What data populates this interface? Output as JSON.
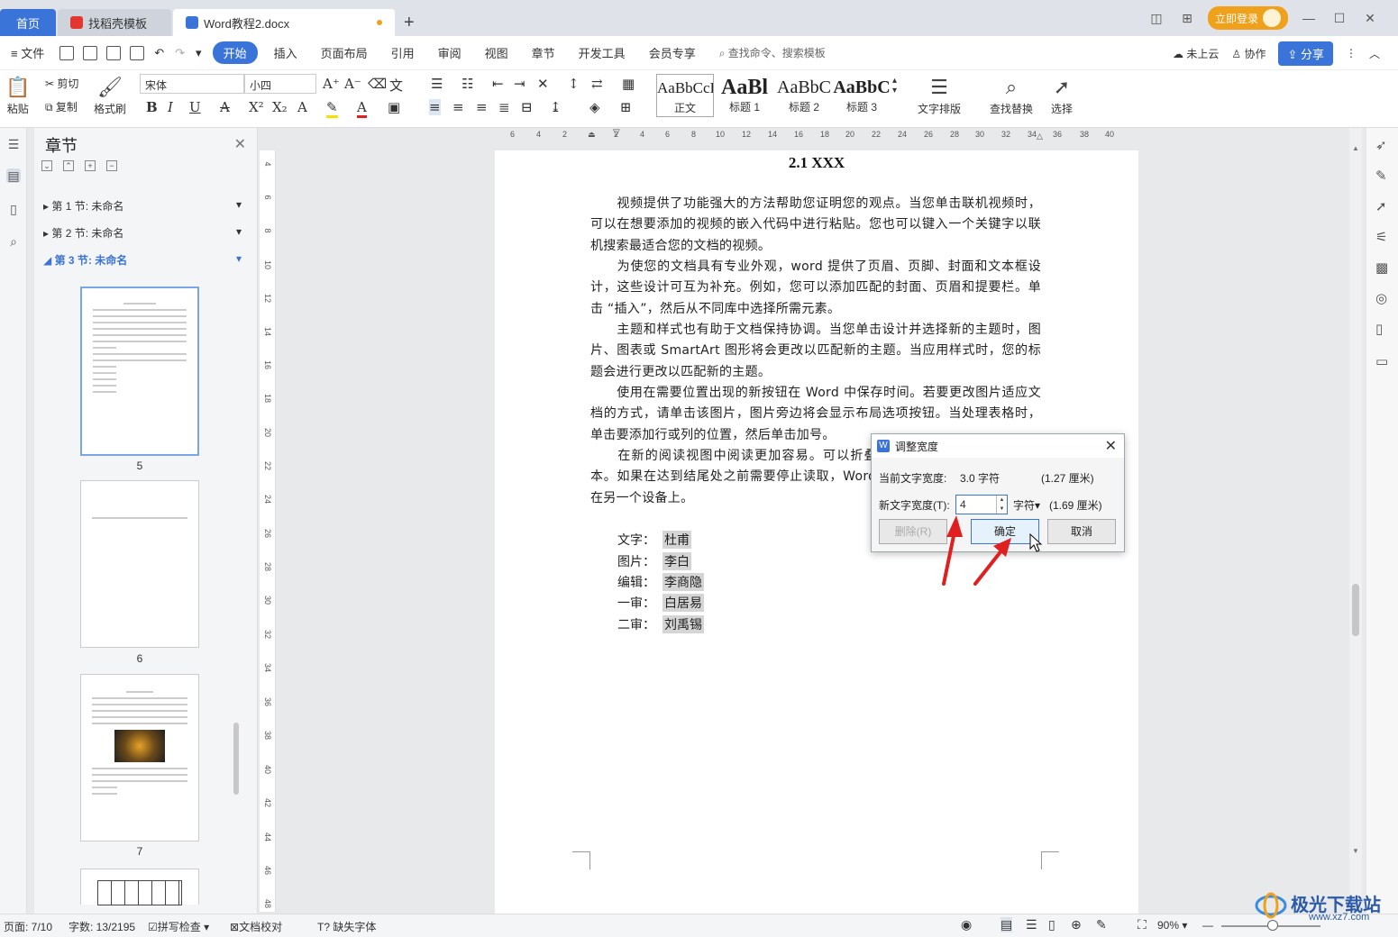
{
  "titlebar": {
    "tabs": [
      {
        "label": "首页"
      },
      {
        "label": "找稻壳模板"
      },
      {
        "label": "Word教程2.docx"
      }
    ],
    "login_label": "立即登录"
  },
  "menubar": {
    "file_label": "文件",
    "items": [
      "开始",
      "插入",
      "页面布局",
      "引用",
      "审阅",
      "视图",
      "章节",
      "开发工具",
      "会员专享"
    ],
    "search_placeholder": "查找命令、搜索模板",
    "cloud_label": "未上云",
    "collab_label": "协作",
    "share_label": "分享"
  },
  "ribbon": {
    "paste": "粘贴",
    "cut": "剪切",
    "copy": "复制",
    "format_painter": "格式刷",
    "font_name": "宋体",
    "font_size": "小四",
    "styles": [
      {
        "sample": "AaBbCcI",
        "name": "正文"
      },
      {
        "sample": "AaBl",
        "name": "标题 1"
      },
      {
        "sample": "AaBbC",
        "name": "标题 2"
      },
      {
        "sample": "AaBbC",
        "name": "标题 3"
      }
    ],
    "text_layout": "文字排版",
    "find_replace": "查找替换",
    "select": "选择"
  },
  "panel": {
    "title": "章节",
    "sections": [
      {
        "label": "第 1 节: 未命名"
      },
      {
        "label": "第 2 节: 未命名"
      },
      {
        "label": "第 3 节: 未命名"
      }
    ],
    "page_numbers": [
      "5",
      "6",
      "7"
    ]
  },
  "ruler": {
    "h_ticks": [
      "6",
      "4",
      "2",
      "2",
      "4",
      "6",
      "8",
      "10",
      "12",
      "14",
      "16",
      "18",
      "20",
      "22",
      "24",
      "26",
      "28",
      "30",
      "32",
      "34",
      "36",
      "38",
      "40"
    ],
    "v_ticks": [
      "4",
      "6",
      "8",
      "10",
      "12",
      "14",
      "16",
      "18",
      "20",
      "22",
      "24",
      "26",
      "28",
      "30",
      "32",
      "34",
      "36",
      "38",
      "40",
      "42",
      "44",
      "46",
      "48"
    ]
  },
  "document": {
    "heading": "2.1 XXX",
    "paragraphs": [
      "　　视频提供了功能强大的方法帮助您证明您的观点。当您单击联机视频时，可以在想要添加的视频的嵌入代码中进行粘贴。您也可以键入一个关键字以联机搜索最适合您的文档的视频。",
      "　　为使您的文档具有专业外观，word 提供了页眉、页脚、封面和文本框设计，这些设计可互为补充。例如，您可以添加匹配的封面、页眉和提要栏。单击 “插入”，然后从不同库中选择所需元素。",
      "　　主题和样式也有助于文档保持协调。当您单击设计并选择新的主题时，图片、图表或 SmartArt 图形将会更改以匹配新的主题。当应用样式时，您的标题会进行更改以匹配新的主题。",
      "　　使用在需要位置出现的新按钮在 Word 中保存时间。若要更改图片适应文档的方式，请单击该图片，图片旁边将会显示布局选项按钮。当处理表格时，单击要添加行或列的位置，然后单击加号。",
      "　　在新的阅读视图中阅读更加容易。可以折叠文档某些部分并关注所需文本。如果在达到结尾处之前需要停止读取，Word 会记住您的停止位置 - 即使在另一个设备上。"
    ],
    "credits": [
      {
        "key": "文字：",
        "value": "杜甫"
      },
      {
        "key": "图片：",
        "value": "李白"
      },
      {
        "key": "编辑：",
        "value": "李商隐"
      },
      {
        "key": "一审：",
        "value": "白居易"
      },
      {
        "key": "二审：",
        "value": "刘禹锡"
      }
    ]
  },
  "dialog": {
    "title": "调整宽度",
    "current_label": "当前文字宽度:",
    "current_value": "3.0 字符",
    "current_cm": "(1.27 厘米)",
    "new_label": "新文字宽度(T):",
    "new_value": "4",
    "unit": "字符",
    "new_cm": "(1.69 厘米)",
    "delete_label": "删除(R)",
    "ok_label": "确定",
    "cancel_label": "取消"
  },
  "statusbar": {
    "page": "页面: 7/10",
    "words": "字数: 13/2195",
    "spell": "拼写检查",
    "proof": "文档校对",
    "missing_font": "缺失字体",
    "zoom": "90%"
  },
  "watermark": {
    "text": "极光下载站",
    "url": "www.xz7.com"
  },
  "colors": {
    "accent": "#3b74d8",
    "login": "#f0a11c",
    "arrow": "#e02020"
  }
}
